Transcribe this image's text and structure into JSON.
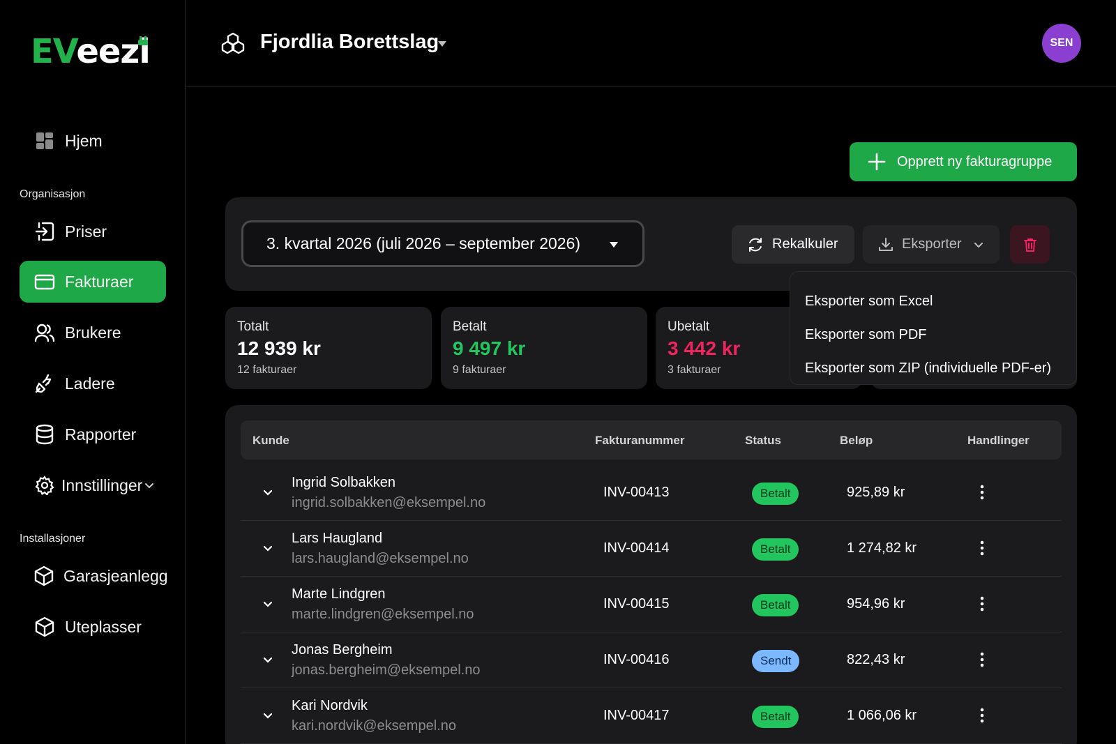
{
  "brand": {
    "logo_ev": "EV",
    "logo_ezi": "eezi",
    "accent": "#1fa847"
  },
  "sidebar": {
    "home": "Hjem",
    "section_org": "Organisasjon",
    "items": [
      {
        "label": "Priser",
        "icon": "login-icon"
      },
      {
        "label": "Fakturaer",
        "icon": "credit-card-icon",
        "active": true
      },
      {
        "label": "Brukere",
        "icon": "users-icon"
      },
      {
        "label": "Ladere",
        "icon": "plug-icon"
      },
      {
        "label": "Rapporter",
        "icon": "database-icon"
      },
      {
        "label": "Innstillinger",
        "icon": "gear-icon"
      }
    ],
    "section_install": "Installasjoner",
    "installations": [
      {
        "label": "Garasjeanlegg",
        "icon": "cube-icon"
      },
      {
        "label": "Uteplasser",
        "icon": "cube-icon"
      }
    ]
  },
  "header": {
    "org_name": "Fjordlia Borettslag",
    "avatar": "SEN"
  },
  "actions": {
    "create": "Opprett ny fakturagruppe",
    "period": "3. kvartal 2026 (juli 2026 – september 2026)",
    "recalc": "Rekalkuler",
    "export": "Eksporter"
  },
  "export_menu": [
    "Eksporter som Excel",
    "Eksporter som PDF",
    "Eksporter som ZIP (individuelle PDF-er)"
  ],
  "stats": [
    {
      "label": "Totalt",
      "value": "12 939 kr",
      "sub": "12 fakturaer"
    },
    {
      "label": "Betalt",
      "value": "9 497 kr",
      "sub": "9 fakturaer"
    },
    {
      "label": "Ubetalt",
      "value": "3 442 kr",
      "sub": "3 fakturaer"
    }
  ],
  "table": {
    "headers": {
      "customer": "Kunde",
      "invoice": "Fakturanummer",
      "status": "Status",
      "amount": "Beløp",
      "actions": "Handlinger"
    },
    "rows": [
      {
        "name": "Ingrid Solbakken",
        "email": "ingrid.solbakken@eksempel.no",
        "invoice": "INV-00413",
        "status": "Betalt",
        "amount": "925,89 kr"
      },
      {
        "name": "Lars Haugland",
        "email": "lars.haugland@eksempel.no",
        "invoice": "INV-00414",
        "status": "Betalt",
        "amount": "1 274,82 kr"
      },
      {
        "name": "Marte Lindgren",
        "email": "marte.lindgren@eksempel.no",
        "invoice": "INV-00415",
        "status": "Betalt",
        "amount": "954,96 kr"
      },
      {
        "name": "Jonas Bergheim",
        "email": "jonas.bergheim@eksempel.no",
        "invoice": "INV-00416",
        "status": "Sendt",
        "amount": "822,43 kr"
      },
      {
        "name": "Kari Nordvik",
        "email": "kari.nordvik@eksempel.no",
        "invoice": "INV-00417",
        "status": "Betalt",
        "amount": "1 066,06 kr"
      }
    ]
  }
}
